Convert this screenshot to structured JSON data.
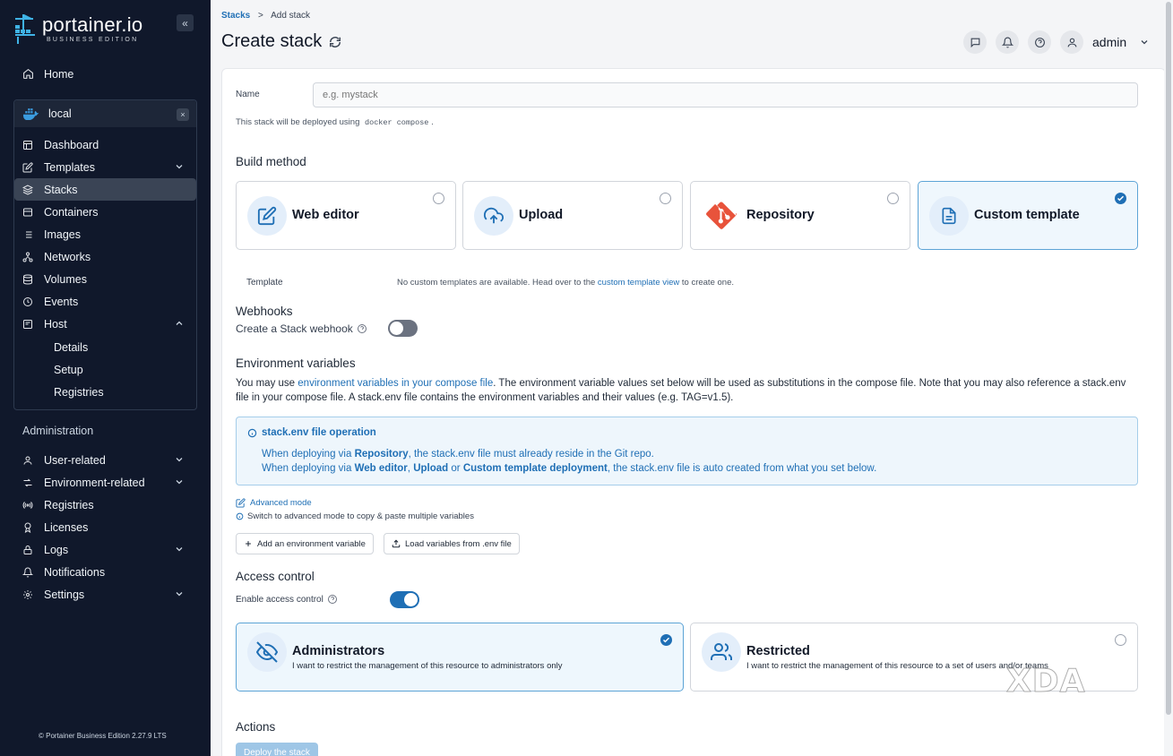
{
  "brand": {
    "name": "portainer.io",
    "edition": "BUSINESS EDITION"
  },
  "sidebar": {
    "collapse_icon": "«",
    "home": "Home",
    "environment": {
      "name": "local",
      "close": "×"
    },
    "env_items": [
      "Dashboard",
      "Templates",
      "Stacks",
      "Containers",
      "Images",
      "Networks",
      "Volumes",
      "Events",
      "Host"
    ],
    "host_sub": [
      "Details",
      "Setup",
      "Registries"
    ],
    "admin_heading": "Administration",
    "admin_items": [
      "User-related",
      "Environment-related",
      "Registries",
      "Licenses",
      "Logs",
      "Notifications",
      "Settings"
    ],
    "footer": "© Portainer Business Edition 2.27.9 LTS"
  },
  "header": {
    "breadcrumb_root": "Stacks",
    "breadcrumb_sep": ">",
    "breadcrumb_current": "Add stack",
    "title": "Create stack",
    "user": "admin"
  },
  "form": {
    "name_label": "Name",
    "name_placeholder": "e.g. mystack",
    "deploy_note_pre": "This stack will be deployed using",
    "deploy_note_code": "docker compose",
    "deploy_note_post": ".",
    "build_method_title": "Build method",
    "build_methods": [
      {
        "label": "Web editor",
        "icon": "edit-icon",
        "selected": false
      },
      {
        "label": "Upload",
        "icon": "upload-cloud-icon",
        "selected": false
      },
      {
        "label": "Repository",
        "icon": "git-icon",
        "selected": false
      },
      {
        "label": "Custom template",
        "icon": "file-icon",
        "selected": true
      }
    ],
    "template_label": "Template",
    "template_note_pre": "No custom templates are available. Head over to the",
    "template_note_link": "custom template view",
    "template_note_post": "to create one.",
    "webhooks_title": "Webhooks",
    "webhook_label": "Create a Stack webhook",
    "webhook_enabled": false,
    "env_title": "Environment variables",
    "env_text_1": "You may use",
    "env_text_link": "environment variables in your compose file",
    "env_text_2": ". The environment variable values set below will be used as substitutions in the compose file. Note that you may also reference a stack.env file in your compose file. A stack.env file contains the environment variables and their values (e.g. TAG=v1.5).",
    "info_title": "stack.env file operation",
    "info_l1_a": "When deploying via",
    "info_l1_b": "Repository",
    "info_l1_c": ", the stack.env file must already reside in the Git repo.",
    "info_l2_a": "When deploying via",
    "info_l2_b": "Web editor",
    "info_l2_c": ",",
    "info_l2_d": "Upload",
    "info_l2_e": "or",
    "info_l2_f": "Custom template deployment",
    "info_l2_g": ", the stack.env file is auto created from what you set below.",
    "advanced_mode": "Advanced mode",
    "advanced_hint": "Switch to advanced mode to copy & paste multiple variables",
    "add_env_var": "Add an environment variable",
    "load_env": "Load variables from .env file",
    "access_title": "Access control",
    "access_label": "Enable access control",
    "access_enabled": true,
    "access_options": [
      {
        "title": "Administrators",
        "desc": "I want to restrict the management of this resource to administrators only",
        "selected": true
      },
      {
        "title": "Restricted",
        "desc": "I want to restrict the management of this resource to a set of users and/or teams",
        "selected": false
      }
    ],
    "actions_title": "Actions",
    "deploy_button": "Deploy the stack"
  },
  "colors": {
    "accent": "#1f6fb5",
    "sidebar_bg": "#10182b",
    "toggle_on": "#1f6fb5",
    "toggle_off": "#6b7280"
  },
  "watermark": "XDA"
}
